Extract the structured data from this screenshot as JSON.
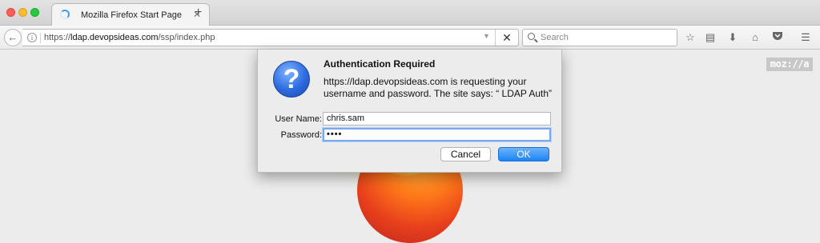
{
  "browser": {
    "tab": {
      "title": "Mozilla Firefox Start Page",
      "close": "✕"
    },
    "new_tab": "+",
    "url": {
      "scheme": "https://",
      "host": "ldap.devopsideas.com",
      "path": "/ssp/index.php"
    },
    "search": {
      "placeholder": "Search"
    },
    "toolbar_icons": [
      "star-icon",
      "reading-list-icon",
      "download-icon",
      "home-icon",
      "pocket-icon",
      "menu-icon"
    ]
  },
  "page": {
    "logo_text": "moz://a"
  },
  "dialog": {
    "title": "Authentication Required",
    "message": "https://ldap.devopsideas.com is requesting your username and password. The site says: “ LDAP Auth”",
    "username_label": "User Name:",
    "username_value": "chris.sam",
    "password_label": "Password:",
    "password_value": "••••",
    "cancel_label": "Cancel",
    "ok_label": "OK"
  },
  "colors": {
    "ok_button": "#1d83f4",
    "question_icon": "#2d6bdf",
    "page_bg": "#ececec"
  }
}
